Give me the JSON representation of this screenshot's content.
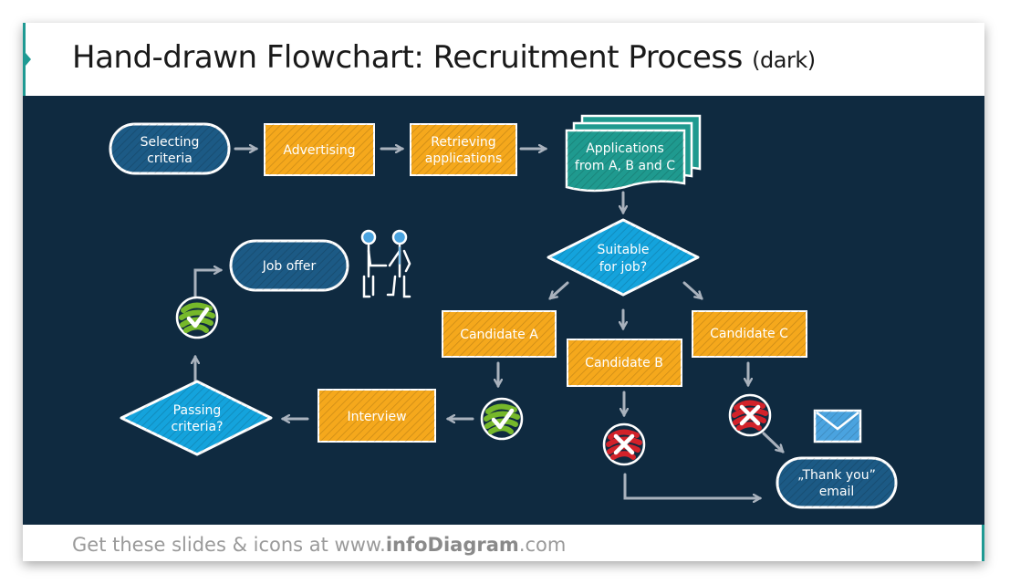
{
  "title": {
    "main": "Hand-drawn Flowchart: Recruitment Process",
    "suffix": "(dark)"
  },
  "footer": {
    "prefix": "Get these slides & icons at www.",
    "brand": "infoDiagram",
    "suffix": ".com"
  },
  "colors": {
    "background": "#0f2a40",
    "accent_teal": "#1f9a93",
    "terminal_blue": "#1c5a85",
    "process_orange": "#f5a81c",
    "decision_cyan": "#14a3dc",
    "document_teal": "#1f9a8f",
    "check_green": "#76b82a",
    "cross_red": "#d2222a",
    "arrow_gray": "#a9b2bd"
  },
  "nodes": {
    "selecting_criteria": {
      "line1": "Selecting",
      "line2": "criteria"
    },
    "advertising": {
      "label": "Advertising"
    },
    "retrieving_applications": {
      "line1": "Retrieving",
      "line2": "applications"
    },
    "applications": {
      "line1": "Applications",
      "line2": "from A, B and C"
    },
    "suitable_for_job": {
      "line1": "Suitable",
      "line2": "for job?"
    },
    "candidate_a": {
      "label": "Candidate A"
    },
    "candidate_b": {
      "label": "Candidate B"
    },
    "candidate_c": {
      "label": "Candidate C"
    },
    "interview": {
      "label": "Interview"
    },
    "passing_criteria": {
      "line1": "Passing",
      "line2": "criteria?"
    },
    "job_offer": {
      "label": "Job offer"
    },
    "thank_you_email": {
      "line1": "„Thank you”",
      "line2": "email"
    }
  },
  "icons": {
    "check_a": "check-icon",
    "check_passing": "check-icon",
    "cross_b": "cross-icon",
    "cross_c": "cross-icon",
    "handshake": "handshake-icon",
    "envelope": "envelope-icon"
  }
}
